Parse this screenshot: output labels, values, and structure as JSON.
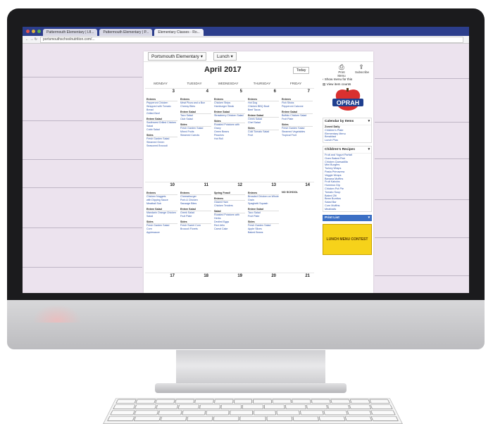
{
  "browser": {
    "tabs": [
      "Pattermouth Elementary | Lfl...",
      "Pattermouth Elementary | P...",
      "Elementary Classes - Ro..."
    ],
    "url": "portsmouthschoolnutrition.com/...",
    "url_prefix": "← → ↻"
  },
  "page": {
    "school_select": "Portsmouth Elementary ▾",
    "meal_select": "Lunch ▾",
    "month_title": "April 2017",
    "today_button": "Today"
  },
  "days_header": [
    "MONDAY",
    "TUESDAY",
    "WEDNESDAY",
    "THURSDAY",
    "FRIDAY"
  ],
  "weeks": [
    {
      "days": [
        {
          "num": "3",
          "sections": [
            {
              "t": "Entrees",
              "items": [
                "Pepperoni Chicken Wrapped with Tomato Bread",
                "Grilled Beef"
              ]
            },
            {
              "t": "Entree Salad",
              "items": [
                "Southwest Grilled Chicken Salad",
                "Cobb Salad"
              ]
            },
            {
              "t": "Sides",
              "items": [
                "Fresh Garden Salad",
                "Steamed Green",
                "Seasoned Broccoli"
              ]
            }
          ]
        },
        {
          "num": "4",
          "sections": [
            {
              "t": "Entrees",
              "items": [
                "Meat Pizza and a Bun",
                "Cheesy Bites"
              ]
            },
            {
              "t": "Entree Salad",
              "items": [
                "Taco Salad",
                "Club Salad"
              ]
            },
            {
              "t": "Sides",
              "items": [
                "Fresh Garden Salad",
                "Mixed Fruits",
                "Steamed Carrots"
              ]
            }
          ]
        },
        {
          "num": "5",
          "sections": [
            {
              "t": "Entrees",
              "items": [
                "Chicken Strips",
                "Hamburger Steak"
              ]
            },
            {
              "t": "Entree Salad",
              "items": [
                "Strawberry Chicken Salad"
              ]
            },
            {
              "t": "Sides",
              "items": [
                "Roasted Potatoes with Gravy",
                "Green Beans",
                "Peaches",
                "Hot Roll"
              ]
            }
          ]
        },
        {
          "num": "6",
          "sections": [
            {
              "t": "Entrees",
              "items": [
                "Hot Dog",
                "Chicken BBQ Bowl",
                "Beef Tacos"
              ]
            },
            {
              "t": "Entree Salad",
              "items": [
                "Greek Salad",
                "Chef Salad"
              ]
            },
            {
              "t": "Sides",
              "items": [
                "Cold Tomato Salad",
                "Fruit"
              ]
            }
          ]
        },
        {
          "num": "7",
          "sections": [
            {
              "t": "Entrees",
              "items": [
                "Fish Sticks",
                "Pepperoni Calzone"
              ]
            },
            {
              "t": "Entree Salad",
              "items": [
                "Buffalo Chicken Salad",
                "Fruit Plate"
              ]
            },
            {
              "t": "Sides",
              "items": [
                "Fresh Garden Salad",
                "Steamed Vegetables",
                "Tropical Fruit"
              ]
            }
          ]
        }
      ]
    },
    {
      "days": [
        {
          "num": "10",
          "sections": [
            {
              "t": "Entrees",
              "items": [
                "Chicken Nuggets",
                "with Dipping Sauce",
                "Meatball Sub"
              ]
            },
            {
              "t": "Entree Salad",
              "items": [
                "Mandarin Orange Chicken Salad"
              ]
            },
            {
              "t": "Sides",
              "items": [
                "Fresh Garden Salad",
                "Corn",
                "Applesauce"
              ]
            }
          ]
        },
        {
          "num": "11",
          "sections": [
            {
              "t": "Entrees",
              "items": [
                "Cheeseburger",
                "Pork & Chicken",
                "Sausage Bites"
              ]
            },
            {
              "t": "Entree Salad",
              "items": [
                "Greek Salad",
                "Fruit Plate"
              ]
            },
            {
              "t": "Sides",
              "items": [
                "Fresh Sweet Corn",
                "Broccoli Florets"
              ]
            }
          ]
        },
        {
          "num": "12",
          "sections": [
            {
              "t": "Spring Feast!",
              "items": []
            },
            {
              "t": "Entrees",
              "items": [
                "Glazed Ham",
                "Chicken Tenders"
              ]
            },
            {
              "t": "Salad",
              "items": [
                "Roasted Potatoes with Herbs",
                "Deviled Eggs",
                "Red Jello",
                "Carrot Cake"
              ]
            }
          ]
        },
        {
          "num": "13",
          "sections": [
            {
              "t": "Entrees",
              "items": [
                "Breaded Chicken on Whole Grain",
                "Spaghetti Squash"
              ]
            },
            {
              "t": "Entree Salad",
              "items": [
                "Taco Salad",
                "Fruit Plate"
              ]
            },
            {
              "t": "Sides",
              "items": [
                "Fresh Garden Salad",
                "Apple Slices",
                "Baked Beans"
              ]
            }
          ]
        },
        {
          "num": "14",
          "note": "NO SCHOOL",
          "sections": []
        }
      ]
    },
    {
      "days": [
        {
          "num": "17",
          "sections": []
        },
        {
          "num": "18",
          "sections": []
        },
        {
          "num": "19",
          "sections": []
        },
        {
          "num": "20",
          "sections": []
        },
        {
          "num": "21",
          "sections": []
        }
      ]
    }
  ],
  "sidebar": {
    "icon_print": "Print Menu",
    "icon_share": "Subscribe",
    "link_show_menu": "‹ Show menu for this",
    "link_view_counts": "▤ View item counts",
    "logo_text": "OPRAH",
    "panel1_title": "Calendar by Items",
    "panel1_sub": "Zoned Daily",
    "panel1_links": [
      "Children's Plate",
      "Elementary Menu",
      "Breakfast",
      "Lunch Plus"
    ],
    "panel2_title": "Children's Recipes",
    "panel2_links": [
      "Fruit and Yogurt Parfait",
      "Oven Baked Fish",
      "Chicken Quesadilla",
      "Mini Burgers",
      "Turkey Wraps",
      "Pasta Primavera",
      "Veggie Wraps",
      "Banana Muffins",
      "Fruit Kabobs",
      "Hummus Dip",
      "Chicken Pot Pie",
      "Tomato Soup",
      "Baked Ziti",
      "Bean Burritos",
      "Salad Bar",
      "Corn Muffins",
      "Meatballs"
    ],
    "print_list": "Print List",
    "ad_text": "LUNCH MENU CONTEST"
  },
  "colors": {
    "browser_bar": "#2c3e8c",
    "link": "#2c52a8",
    "backdrop": "#ece3ee",
    "print_btn": "#3b6fc4",
    "ad": "#f6d21a"
  }
}
